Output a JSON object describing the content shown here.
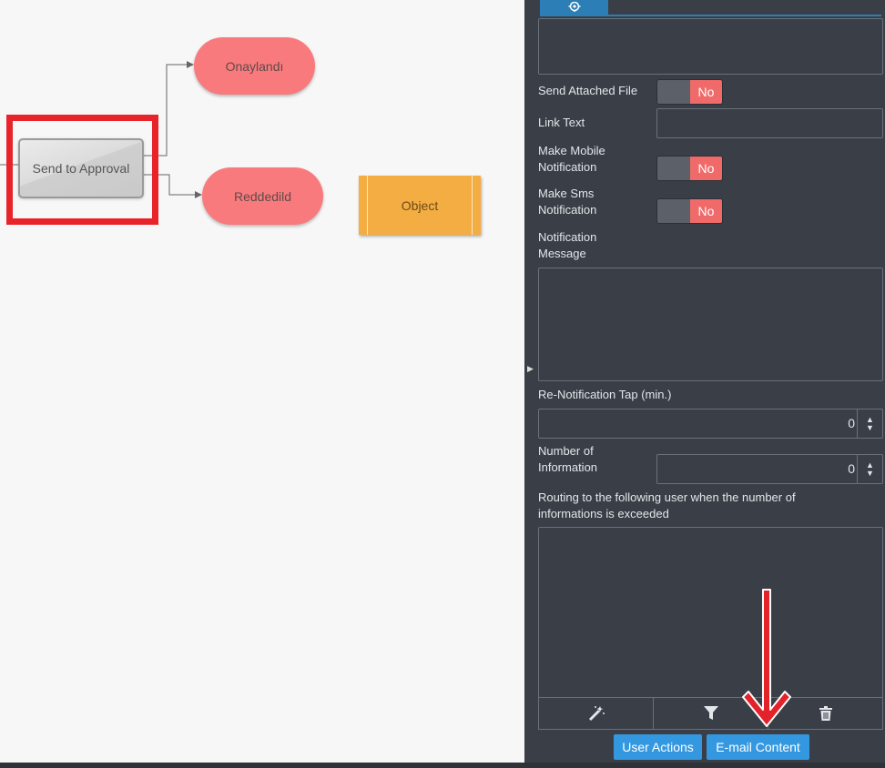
{
  "canvas": {
    "nodes": {
      "approved": "Onaylandı",
      "rejected": "Reddedild",
      "send_to_approval": "Send to Approval",
      "object": "Object"
    }
  },
  "panel": {
    "tab_icon": "gear-icon",
    "send_attached_file": {
      "label": "Send Attached File",
      "state": "No"
    },
    "link_text": {
      "label": "Link Text",
      "value": ""
    },
    "make_mobile_notification": {
      "label_line1": "Make Mobile",
      "label_line2": "Notification",
      "state": "No"
    },
    "make_sms_notification": {
      "label_line1": "Make Sms",
      "label_line2": "Notification",
      "state": "No"
    },
    "notification_message": {
      "label_line1": "Notification",
      "label_line2": "Message",
      "value": ""
    },
    "renotification_tap": {
      "label": "Re-Notification Tap (min.)",
      "value": "0"
    },
    "number_of_information": {
      "label_line1": "Number of",
      "label_line2": "Information",
      "value": "0"
    },
    "routing": {
      "label_line1": "Routing to the following user when the number of",
      "label_line2": "informations is exceeded"
    },
    "tools": [
      "magic-wand-icon",
      "filter-icon",
      "trash-icon"
    ],
    "buttons": {
      "user_actions": "User Actions",
      "email_content": "E-mail Content"
    }
  },
  "colors": {
    "accent": "#3498e0",
    "toggle_no": "#f06a6a",
    "node_end": "#f97a7c",
    "node_object": "#f4ad42",
    "highlight": "#e8232a"
  }
}
